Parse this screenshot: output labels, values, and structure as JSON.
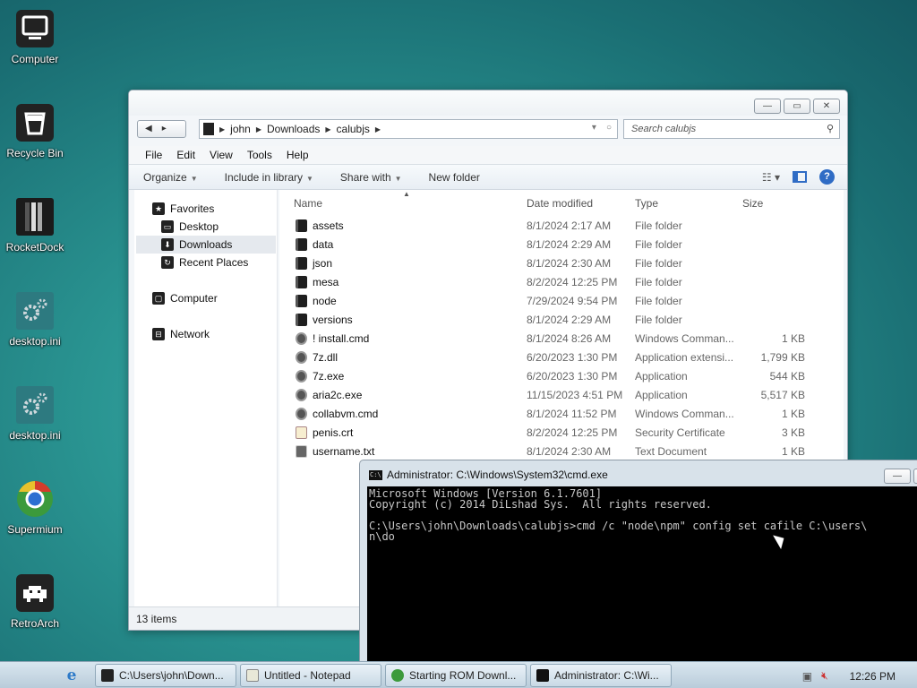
{
  "desktop": {
    "icons": [
      {
        "label": "Computer",
        "icon": "computer-icon"
      },
      {
        "label": "Recycle Bin",
        "icon": "recycle-bin-icon"
      },
      {
        "label": "RocketDock",
        "icon": "rocketdock-icon"
      },
      {
        "label": "desktop.ini",
        "icon": "settings-file-icon"
      },
      {
        "label": "desktop.ini",
        "icon": "settings-file-icon"
      },
      {
        "label": "Supermium",
        "icon": "supermium-browser-icon"
      },
      {
        "label": "RetroArch",
        "icon": "retroarch-icon"
      }
    ]
  },
  "explorer": {
    "breadcrumb": [
      "john",
      "Downloads",
      "calubjs"
    ],
    "search_placeholder": "Search calubjs",
    "menu": [
      "File",
      "Edit",
      "View",
      "Tools",
      "Help"
    ],
    "commands": {
      "organize": "Organize",
      "include": "Include in library",
      "share": "Share with",
      "new_folder": "New folder"
    },
    "nav": {
      "favorites": "Favorites",
      "desktop": "Desktop",
      "downloads": "Downloads",
      "recent": "Recent Places",
      "computer": "Computer",
      "network": "Network"
    },
    "columns": {
      "name": "Name",
      "date": "Date modified",
      "type": "Type",
      "size": "Size"
    },
    "files": [
      {
        "name": "assets",
        "date": "8/1/2024 2:17 AM",
        "type": "File folder",
        "size": "",
        "kind": "folder"
      },
      {
        "name": "data",
        "date": "8/1/2024 2:29 AM",
        "type": "File folder",
        "size": "",
        "kind": "folder"
      },
      {
        "name": "json",
        "date": "8/1/2024 2:30 AM",
        "type": "File folder",
        "size": "",
        "kind": "folder"
      },
      {
        "name": "mesa",
        "date": "8/2/2024 12:25 PM",
        "type": "File folder",
        "size": "",
        "kind": "folder"
      },
      {
        "name": "node",
        "date": "7/29/2024 9:54 PM",
        "type": "File folder",
        "size": "",
        "kind": "folder"
      },
      {
        "name": "versions",
        "date": "8/1/2024 2:29 AM",
        "type": "File folder",
        "size": "",
        "kind": "folder"
      },
      {
        "name": "! install.cmd",
        "date": "8/1/2024 8:26 AM",
        "type": "Windows Comman...",
        "size": "1 KB",
        "kind": "app"
      },
      {
        "name": "7z.dll",
        "date": "6/20/2023 1:30 PM",
        "type": "Application extensi...",
        "size": "1,799 KB",
        "kind": "app"
      },
      {
        "name": "7z.exe",
        "date": "6/20/2023 1:30 PM",
        "type": "Application",
        "size": "544 KB",
        "kind": "app"
      },
      {
        "name": "aria2c.exe",
        "date": "11/15/2023 4:51 PM",
        "type": "Application",
        "size": "5,517 KB",
        "kind": "app"
      },
      {
        "name": "collabvm.cmd",
        "date": "8/1/2024 11:52 PM",
        "type": "Windows Comman...",
        "size": "1 KB",
        "kind": "app"
      },
      {
        "name": "penis.crt",
        "date": "8/2/2024 12:25 PM",
        "type": "Security Certificate",
        "size": "3 KB",
        "kind": "cert"
      },
      {
        "name": "username.txt",
        "date": "8/1/2024 2:30 AM",
        "type": "Text Document",
        "size": "1 KB",
        "kind": "doc"
      }
    ],
    "status": "13 items"
  },
  "cmd": {
    "title": "Administrator: C:\\Windows\\System32\\cmd.exe",
    "lines": [
      "Microsoft Windows [Version 6.1.7601]",
      "Copyright (c) 2014 DiLshad Sys.  All rights reserved.",
      "",
      "C:\\Users\\john\\Downloads\\calubjs>cmd /c \"node\\npm\" config set cafile C:\\users\\",
      "n\\do"
    ]
  },
  "taskbar": {
    "tasks": [
      {
        "label": "C:\\Users\\john\\Down...",
        "icon": "folder-icon"
      },
      {
        "label": "Untitled - Notepad",
        "icon": "notepad-icon"
      },
      {
        "label": "Starting ROM Downl...",
        "icon": "supermium-icon"
      },
      {
        "label": "Administrator: C:\\Wi...",
        "icon": "cmd-icon"
      }
    ],
    "clock": "12:26 PM"
  }
}
